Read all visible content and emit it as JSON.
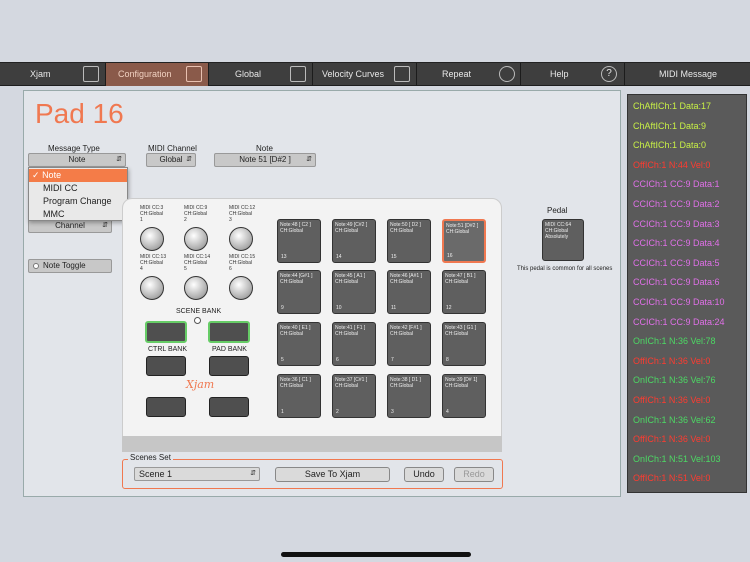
{
  "nav": {
    "tabs": [
      {
        "label": "Xjam",
        "icon": "xjam-icon"
      },
      {
        "label": "Configuration",
        "icon": "pads-icon"
      },
      {
        "label": "Global",
        "icon": "global-icon"
      },
      {
        "label": "Velocity Curves",
        "icon": "curve-icon"
      },
      {
        "label": "Repeat",
        "icon": "timer-icon"
      },
      {
        "label": "Help",
        "icon": "help-icon"
      },
      {
        "label": "MIDI Message",
        "icon": ""
      }
    ],
    "help_glyph": "?"
  },
  "pad_title": "Pad 16",
  "message_type": {
    "label": "Message Type",
    "value": "Note"
  },
  "midi_channel": {
    "label": "MIDI Channel",
    "value": "Global"
  },
  "note": {
    "label": "Note",
    "value": "Note 51 [D#2 ]"
  },
  "dropdown": {
    "check": "✓",
    "options": [
      "Note",
      "MIDI CC",
      "Program Change",
      "MMC"
    ]
  },
  "channel_select": "Channel",
  "note_toggle": "Note Toggle",
  "knobs": [
    {
      "l1": "MIDI CC:3",
      "l2": "CH:Global",
      "n": "1"
    },
    {
      "l1": "MIDI CC:9",
      "l2": "CH:Global",
      "n": "2"
    },
    {
      "l1": "MIDI CC:12",
      "l2": "CH:Global",
      "n": "3"
    },
    {
      "l1": "MIDI CC:13",
      "l2": "CH:Global",
      "n": "4"
    },
    {
      "l1": "MIDI CC:14",
      "l2": "CH:Global",
      "n": "5"
    },
    {
      "l1": "MIDI CC:15",
      "l2": "CH:Global",
      "n": "6"
    }
  ],
  "scene_bank": "SCENE BANK",
  "ctrl_bank": "CTRL BANK",
  "pad_bank": "PAD BANK",
  "logo": "Xjam",
  "pads": [
    {
      "note": "Note:48 [ C2 ]",
      "ch": "CH:Global",
      "n": "13"
    },
    {
      "note": "Note:49 [C#2 ]",
      "ch": "CH:Global",
      "n": "14"
    },
    {
      "note": "Note:50 [ D2 ]",
      "ch": "CH:Global",
      "n": "15"
    },
    {
      "note": "Note:51 [D#2 ]",
      "ch": "CH:Global",
      "n": "16"
    },
    {
      "note": "Note:44 [G#1 ]",
      "ch": "CH:Global",
      "n": "9"
    },
    {
      "note": "Note:45 [ A1 ]",
      "ch": "CH:Global",
      "n": "10"
    },
    {
      "note": "Note:46 [A#1 ]",
      "ch": "CH:Global",
      "n": "11"
    },
    {
      "note": "Note:47 [ B1 ]",
      "ch": "CH:Global",
      "n": "12"
    },
    {
      "note": "Note:40 [ E1 ]",
      "ch": "CH:Global",
      "n": "5"
    },
    {
      "note": "Note:41 [ F1 ]",
      "ch": "CH:Global",
      "n": "6"
    },
    {
      "note": "Note:42 [F#1 ]",
      "ch": "CH:Global",
      "n": "7"
    },
    {
      "note": "Note:43 [ G1 ]",
      "ch": "CH:Global",
      "n": "8"
    },
    {
      "note": "Note:36 [ C1 ]",
      "ch": "CH:Global",
      "n": "1"
    },
    {
      "note": "Note:37 [C#1 ]",
      "ch": "CH:Global",
      "n": "2"
    },
    {
      "note": "Note:38 [ D1 ]",
      "ch": "CH:Global",
      "n": "3"
    },
    {
      "note": "Note:39 [D# 1]",
      "ch": "CH:Global",
      "n": "4"
    }
  ],
  "pedal": {
    "title": "Pedal",
    "l1": "MIDI CC:64",
    "l2": "CH:Global",
    "l3": "Absolutely",
    "caption": "This pedal is common for all scenes"
  },
  "scenes_set": {
    "label": "Scenes Set",
    "scene": "Scene 1",
    "save": "Save To Xjam",
    "undo": "Undo",
    "redo": "Redo"
  },
  "midi_messages": [
    {
      "text": "ChAftICh:1 Data:17",
      "color": "#c8f046"
    },
    {
      "text": "ChAftICh:1 Data:9",
      "color": "#c8f046"
    },
    {
      "text": "ChAftICh:1 Data:0",
      "color": "#c8f046"
    },
    {
      "text": "OffICh:1 N:44 Vel:0",
      "color": "#ff3b30"
    },
    {
      "text": "CCICh:1 CC:9 Data:1",
      "color": "#e070e8"
    },
    {
      "text": "CCICh:1 CC:9 Data:2",
      "color": "#e070e8"
    },
    {
      "text": "CCICh:1 CC:9 Data:3",
      "color": "#e070e8"
    },
    {
      "text": "CCICh:1 CC:9 Data:4",
      "color": "#e070e8"
    },
    {
      "text": "CCICh:1 CC:9 Data:5",
      "color": "#e070e8"
    },
    {
      "text": "CCICh:1 CC:9 Data:6",
      "color": "#e070e8"
    },
    {
      "text": "CCICh:1 CC:9 Data:10",
      "color": "#e070e8"
    },
    {
      "text": "CCICh:1 CC:9 Data:24",
      "color": "#e070e8"
    },
    {
      "text": "OnICh:1 N:36 Vel:78",
      "color": "#4cd964"
    },
    {
      "text": "OffICh:1 N:36 Vel:0",
      "color": "#ff3b30"
    },
    {
      "text": "OnICh:1 N:36 Vel:76",
      "color": "#4cd964"
    },
    {
      "text": "OffICh:1 N:36 Vel:0",
      "color": "#ff3b30"
    },
    {
      "text": "OnICh:1 N:36 Vel:62",
      "color": "#4cd964"
    },
    {
      "text": "OffICh:1 N:36 Vel:0",
      "color": "#ff3b30"
    },
    {
      "text": "OnICh:1 N:51 Vel:103",
      "color": "#4cd964"
    },
    {
      "text": "OffICh:1 N:51 Vel:0",
      "color": "#ff3b30"
    }
  ],
  "colors": {
    "accent": "#f07850",
    "nav_bg": "#3e3e3e",
    "active_tab": "#8a5a4a"
  }
}
